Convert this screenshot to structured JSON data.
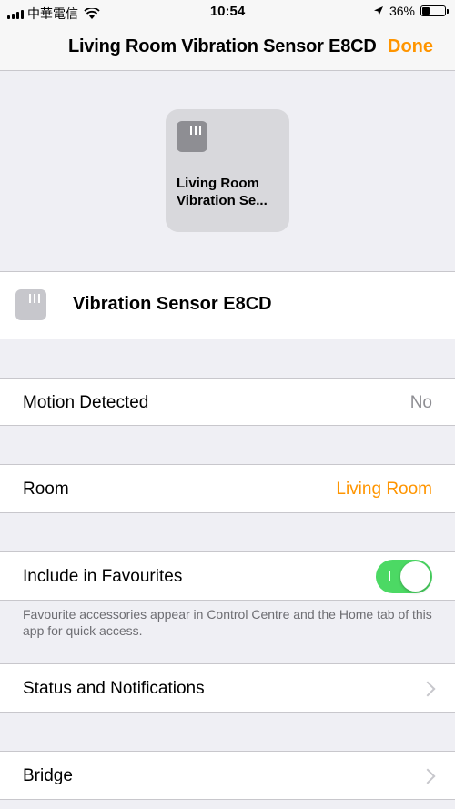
{
  "status_bar": {
    "carrier": "中華電信",
    "time": "10:54",
    "battery_percent": "36%",
    "battery_level": 0.36
  },
  "nav": {
    "title": "Living Room Vibration Sensor E8CD",
    "done_label": "Done"
  },
  "tile": {
    "name": "Living Room\nVibration Se..."
  },
  "device": {
    "name": "Vibration Sensor E8CD"
  },
  "rows": {
    "motion": {
      "label": "Motion Detected",
      "value": "No"
    },
    "room": {
      "label": "Room",
      "value": "Living Room"
    },
    "favourites": {
      "label": "Include in Favourites",
      "toggle_on": true,
      "footer": "Favourite accessories appear in Control Centre and the Home tab of this app for quick access."
    },
    "status": {
      "label": "Status and Notifications"
    },
    "bridge": {
      "label": "Bridge"
    }
  },
  "colors": {
    "accent": "#ff9500",
    "toggle_on": "#4cd964",
    "background": "#efeff4"
  }
}
